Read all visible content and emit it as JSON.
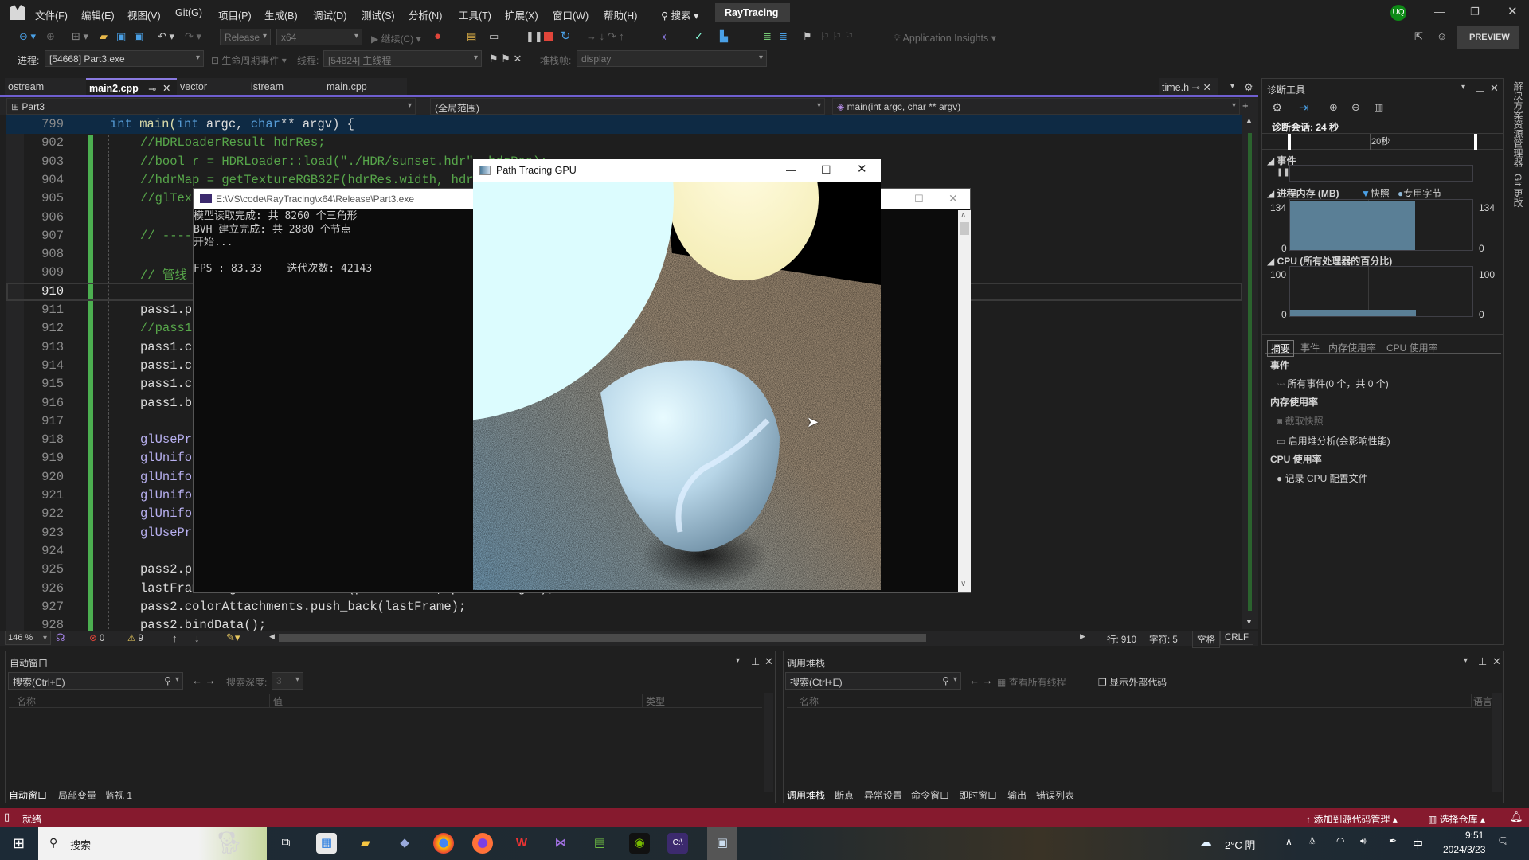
{
  "menubar": {
    "items": [
      "文件(F)",
      "编辑(E)",
      "视图(V)",
      "Git(G)",
      "项目(P)",
      "生成(B)",
      "调试(D)",
      "测试(S)",
      "分析(N)",
      "工具(T)",
      "扩展(X)",
      "窗口(W)",
      "帮助(H)"
    ],
    "search": "搜索",
    "solution": "RayTracing",
    "user_initials": "UQ",
    "preview": "PREVIEW"
  },
  "toolbar": {
    "config": "Release",
    "platform": "x64",
    "continue": "继续(C)",
    "app_insights": "Application Insights"
  },
  "debugbar": {
    "process_label": "进程:",
    "process": "[54668] Part3.exe",
    "lifecycle": "生命周期事件",
    "thread_label": "线程:",
    "thread": "[54824] 主线程",
    "stackframe_label": "堆栈帧:",
    "stackframe": "display"
  },
  "tabs": [
    {
      "label": "ostream"
    },
    {
      "label": "main2.cpp",
      "active": true
    },
    {
      "label": "vector"
    },
    {
      "label": "istream"
    },
    {
      "label": "main.cpp"
    }
  ],
  "right_tab": "time.h",
  "navbar": {
    "project": "Part3",
    "scope": "(全局范围)",
    "member": "main(int argc, char ** argv)"
  },
  "code": [
    {
      "n": "799",
      "text": ""
    },
    {
      "n": "902",
      "text": "//HDRLoaderResult hdrRes;",
      "c": "cm"
    },
    {
      "n": "903",
      "text": "//bool r = HDRLoader::load(\"./HDR/sunset.hdr\", hdrRes);",
      "c": "cm"
    },
    {
      "n": "904",
      "text": "//hdrMap = getTextureRGB32F(hdrRes.width, hdrRes.height);",
      "c": "cm"
    },
    {
      "n": "905",
      "text": "//glTex",
      "c": "cm"
    },
    {
      "n": "906",
      "text": ""
    },
    {
      "n": "907",
      "text": "// -----",
      "c": "cm"
    },
    {
      "n": "908",
      "text": ""
    },
    {
      "n": "909",
      "text": "// 管线",
      "c": "cm"
    },
    {
      "n": "910",
      "text": "",
      "cur": true
    },
    {
      "n": "911",
      "text": "pass1.p",
      "c": "pl"
    },
    {
      "n": "912",
      "text": "//pass1",
      "c": "cm"
    },
    {
      "n": "913",
      "text": "pass1.c",
      "c": "pl"
    },
    {
      "n": "914",
      "text": "pass1.c",
      "c": "pl"
    },
    {
      "n": "915",
      "text": "pass1.c",
      "c": "pl"
    },
    {
      "n": "916",
      "text": "pass1.b",
      "c": "pl"
    },
    {
      "n": "917",
      "text": ""
    },
    {
      "n": "918",
      "text": "glUsePr",
      "c": "gl"
    },
    {
      "n": "919",
      "text": "glUnifo",
      "c": "gl"
    },
    {
      "n": "920",
      "text": "glUnifo",
      "c": "gl"
    },
    {
      "n": "921",
      "text": "glUnifo",
      "c": "gl"
    },
    {
      "n": "922",
      "text": "glUnifo",
      "c": "gl"
    },
    {
      "n": "923",
      "text": "glUsePr",
      "c": "gl"
    },
    {
      "n": "924",
      "text": ""
    },
    {
      "n": "925",
      "text": "pass2.p",
      "c": "pl"
    },
    {
      "n": "926",
      "text": "lastFrame = getTextureRGB32F(pass2.width, pass2.height);",
      "c": "pl"
    },
    {
      "n": "927",
      "text": "pass2.colorAttachments.push_back(lastFrame);",
      "c": "pl"
    },
    {
      "n": "928",
      "text": "pass2.bindData();",
      "c": "pl"
    }
  ],
  "code_main": {
    "kw1": "int",
    "name": " main(",
    "kw2": "int",
    "a1": " argc, ",
    "kw3": "char",
    "a2": "** argv) {"
  },
  "editor_status": {
    "zoom": "146 %",
    "errors": "0",
    "warnings": "9",
    "line": "行: 910",
    "char": "字符: 5",
    "spaces": "空格",
    "eol": "CRLF"
  },
  "console": {
    "title": "E:\\VS\\code\\RayTracing\\x64\\Release\\Part3.exe",
    "lines": [
      "模型读取完成: 共 8260 个三角形",
      "BVH 建立完成: 共 2880 个节点",
      "开始...",
      "",
      "FPS : 83.33    迭代次数: 42143"
    ]
  },
  "render_window": {
    "title": "Path Tracing GPU"
  },
  "diagnostics": {
    "title": "诊断工具",
    "session": "诊断会话: 24 秒",
    "timeline_tick": "20秒",
    "events_header": "事件",
    "memory_header": "进程内存 (MB)",
    "legend_snapshot": "快照",
    "legend_private": "专用字节",
    "mem_max": "134",
    "mem_min": "0",
    "cpu_header": "CPU (所有处理器的百分比)",
    "cpu_max": "100",
    "cpu_min": "0",
    "memory_fill_fraction": 0.97,
    "cpu_fill_fraction": 0.05,
    "tabs": [
      "摘要",
      "事件",
      "内存使用率",
      "CPU 使用率"
    ],
    "sec_events": "事件",
    "all_events": "所有事件(0 个，共 0 个)",
    "sec_memory": "内存使用率",
    "snapshot": "截取快照",
    "heap": "启用堆分析(会影响性能)",
    "sec_cpu": "CPU 使用率",
    "record_cpu": "记录 CPU 配置文件"
  },
  "side_strip": [
    "解决方案资源管理器",
    "Git 更改"
  ],
  "autos": {
    "title": "自动窗口",
    "search": "搜索(Ctrl+E)",
    "depth_label": "搜索深度:",
    "depth": "3",
    "cols": [
      "名称",
      "值",
      "类型"
    ],
    "tabs": [
      "自动窗口",
      "局部变量",
      "监视 1"
    ]
  },
  "callstack": {
    "title": "调用堆栈",
    "search": "搜索(Ctrl+E)",
    "all_threads": "查看所有线程",
    "external": "显示外部代码",
    "cols": [
      "名称",
      "语言"
    ],
    "tabs": [
      "调用堆栈",
      "断点",
      "异常设置",
      "命令窗口",
      "即时窗口",
      "输出",
      "错误列表"
    ]
  },
  "statusbar": {
    "ready": "就绪",
    "add_source": "添加到源代码管理",
    "select_repo": "选择仓库",
    "color": "#861a2e"
  },
  "taskbar": {
    "search": "搜索",
    "weather": "2°C 阴",
    "ime": "中",
    "time": "9:51",
    "date": "2024/3/23"
  }
}
